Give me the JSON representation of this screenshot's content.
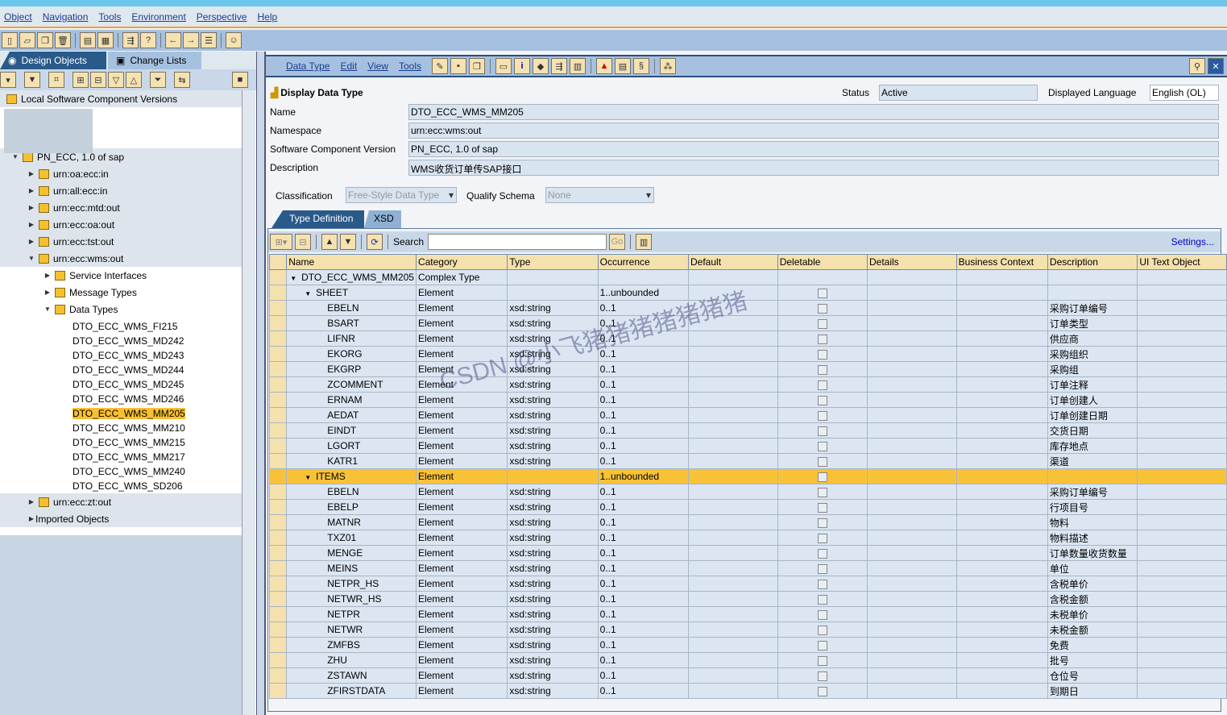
{
  "menu": [
    "Object",
    "Navigation",
    "Tools",
    "Environment",
    "Perspective",
    "Help"
  ],
  "left_tabs": {
    "design": "Design Objects",
    "changes": "Change Lists"
  },
  "tree": [
    {
      "label": "Local Software Component Versions",
      "level": 0,
      "arrow": "",
      "grey": true
    },
    {
      "label": "PN_ECC, 1.0 of sap",
      "level": 1,
      "arrow": "down",
      "grey": true
    },
    {
      "label": "urn:oa:ecc:in",
      "level": 2,
      "arrow": "right",
      "grey": true,
      "icon": true
    },
    {
      "label": "urn:all:ecc:in",
      "level": 2,
      "arrow": "right",
      "grey": true,
      "icon": true
    },
    {
      "label": "urn:ecc:mtd:out",
      "level": 2,
      "arrow": "right",
      "grey": true,
      "icon": true
    },
    {
      "label": "urn:ecc:oa:out",
      "level": 2,
      "arrow": "right",
      "grey": true,
      "icon": true
    },
    {
      "label": "urn:ecc:tst:out",
      "level": 2,
      "arrow": "right",
      "grey": true,
      "icon": true
    },
    {
      "label": "urn:ecc:wms:out",
      "level": 2,
      "arrow": "down",
      "grey": true,
      "icon": true
    },
    {
      "label": "Service Interfaces",
      "level": 3,
      "arrow": "right",
      "icon": true
    },
    {
      "label": "Message Types",
      "level": 3,
      "arrow": "right",
      "icon": true
    },
    {
      "label": "Data Types",
      "level": 3,
      "arrow": "down",
      "icon": true
    },
    {
      "label": "DTO_ECC_WMS_FI215",
      "level": 4
    },
    {
      "label": "DTO_ECC_WMS_MD242",
      "level": 4
    },
    {
      "label": "DTO_ECC_WMS_MD243",
      "level": 4
    },
    {
      "label": "DTO_ECC_WMS_MD244",
      "level": 4
    },
    {
      "label": "DTO_ECC_WMS_MD245",
      "level": 4
    },
    {
      "label": "DTO_ECC_WMS_MD246",
      "level": 4
    },
    {
      "label": "DTO_ECC_WMS_MM205",
      "level": 4,
      "selected": true
    },
    {
      "label": "DTO_ECC_WMS_MM210",
      "level": 4
    },
    {
      "label": "DTO_ECC_WMS_MM215",
      "level": 4
    },
    {
      "label": "DTO_ECC_WMS_MM217",
      "level": 4
    },
    {
      "label": "DTO_ECC_WMS_MM240",
      "level": 4
    },
    {
      "label": "DTO_ECC_WMS_SD206",
      "level": 4
    },
    {
      "label": "urn:ecc:zt:out",
      "level": 2,
      "arrow": "right",
      "grey": true,
      "icon": true
    },
    {
      "label": "Imported Objects",
      "level": 2,
      "arrow": "right",
      "grey": true
    }
  ],
  "editor_menu": [
    "Data Type",
    "Edit",
    "View",
    "Tools"
  ],
  "header": {
    "title": "Display Data Type",
    "status_label": "Status",
    "status": "Active",
    "lang_label": "Displayed Language",
    "lang": "English (OL)"
  },
  "fields": [
    {
      "label": "Name",
      "value": "DTO_ECC_WMS_MM205"
    },
    {
      "label": "Namespace",
      "value": "urn:ecc:wms:out"
    },
    {
      "label": "Software Component Version",
      "value": "PN_ECC, 1.0 of sap"
    },
    {
      "label": "Description",
      "value": "WMS收货订单传SAP接口"
    }
  ],
  "classification": {
    "label": "Classification",
    "value": "Free-Style Data Type",
    "qs_label": "Qualify Schema",
    "qs_value": "None"
  },
  "tabs": [
    "Type Definition",
    "XSD"
  ],
  "search": {
    "label": "Search",
    "value": "",
    "go": "Go",
    "settings": "Settings..."
  },
  "columns": [
    "Name",
    "Category",
    "Type",
    "Occurrence",
    "Default",
    "Deletable",
    "Details",
    "Business Context",
    "Description",
    "UI Text Object"
  ],
  "rows": [
    {
      "name": "DTO_ECC_WMS_MM205",
      "indent": 0,
      "arrow": true,
      "category": "Complex Type",
      "type": "",
      "occ": "",
      "del": false,
      "desc": ""
    },
    {
      "name": "SHEET",
      "indent": 1,
      "arrow": true,
      "category": "Element",
      "type": "",
      "occ": "1..unbounded",
      "del": true,
      "desc": ""
    },
    {
      "name": "EBELN",
      "indent": 2,
      "category": "Element",
      "type": "xsd:string",
      "occ": "0..1",
      "del": true,
      "desc": "采购订单编号"
    },
    {
      "name": "BSART",
      "indent": 2,
      "category": "Element",
      "type": "xsd:string",
      "occ": "0..1",
      "del": true,
      "desc": "订单类型"
    },
    {
      "name": "LIFNR",
      "indent": 2,
      "category": "Element",
      "type": "xsd:string",
      "occ": "0..1",
      "del": true,
      "desc": "供应商"
    },
    {
      "name": "EKORG",
      "indent": 2,
      "category": "Element",
      "type": "xsd:string",
      "occ": "0..1",
      "del": true,
      "desc": "采购组织"
    },
    {
      "name": "EKGRP",
      "indent": 2,
      "category": "Element",
      "type": "xsd:string",
      "occ": "0..1",
      "del": true,
      "desc": "采购组"
    },
    {
      "name": "ZCOMMENT",
      "indent": 2,
      "category": "Element",
      "type": "xsd:string",
      "occ": "0..1",
      "del": true,
      "desc": "订单注释"
    },
    {
      "name": "ERNAM",
      "indent": 2,
      "category": "Element",
      "type": "xsd:string",
      "occ": "0..1",
      "del": true,
      "desc": "订单创建人"
    },
    {
      "name": "AEDAT",
      "indent": 2,
      "category": "Element",
      "type": "xsd:string",
      "occ": "0..1",
      "del": true,
      "desc": "订单创建日期"
    },
    {
      "name": "EINDT",
      "indent": 2,
      "category": "Element",
      "type": "xsd:string",
      "occ": "0..1",
      "del": true,
      "desc": "交货日期"
    },
    {
      "name": "LGORT",
      "indent": 2,
      "category": "Element",
      "type": "xsd:string",
      "occ": "0..1",
      "del": true,
      "desc": "库存地点"
    },
    {
      "name": "KATR1",
      "indent": 2,
      "category": "Element",
      "type": "xsd:string",
      "occ": "0..1",
      "del": true,
      "desc": "渠道"
    },
    {
      "name": "ITEMS",
      "indent": 1,
      "arrow": true,
      "category": "Element",
      "type": "",
      "occ": "1..unbounded",
      "del": true,
      "desc": "",
      "selected": true
    },
    {
      "name": "EBELN",
      "indent": 2,
      "category": "Element",
      "type": "xsd:string",
      "occ": "0..1",
      "del": true,
      "desc": "采购订单编号"
    },
    {
      "name": "EBELP",
      "indent": 2,
      "category": "Element",
      "type": "xsd:string",
      "occ": "0..1",
      "del": true,
      "desc": "行项目号"
    },
    {
      "name": "MATNR",
      "indent": 2,
      "category": "Element",
      "type": "xsd:string",
      "occ": "0..1",
      "del": true,
      "desc": "物料"
    },
    {
      "name": "TXZ01",
      "indent": 2,
      "category": "Element",
      "type": "xsd:string",
      "occ": "0..1",
      "del": true,
      "desc": "物料描述"
    },
    {
      "name": "MENGE",
      "indent": 2,
      "category": "Element",
      "type": "xsd:string",
      "occ": "0..1",
      "del": true,
      "desc": "订单数量收货数量"
    },
    {
      "name": "MEINS",
      "indent": 2,
      "category": "Element",
      "type": "xsd:string",
      "occ": "0..1",
      "del": true,
      "desc": "单位"
    },
    {
      "name": "NETPR_HS",
      "indent": 2,
      "category": "Element",
      "type": "xsd:string",
      "occ": "0..1",
      "del": true,
      "desc": "含税单价"
    },
    {
      "name": "NETWR_HS",
      "indent": 2,
      "category": "Element",
      "type": "xsd:string",
      "occ": "0..1",
      "del": true,
      "desc": "含税金额"
    },
    {
      "name": "NETPR",
      "indent": 2,
      "category": "Element",
      "type": "xsd:string",
      "occ": "0..1",
      "del": true,
      "desc": "未税单价"
    },
    {
      "name": "NETWR",
      "indent": 2,
      "category": "Element",
      "type": "xsd:string",
      "occ": "0..1",
      "del": true,
      "desc": "未税金额"
    },
    {
      "name": "ZMFBS",
      "indent": 2,
      "category": "Element",
      "type": "xsd:string",
      "occ": "0..1",
      "del": true,
      "desc": "免费"
    },
    {
      "name": "ZHU",
      "indent": 2,
      "category": "Element",
      "type": "xsd:string",
      "occ": "0..1",
      "del": true,
      "desc": "批号"
    },
    {
      "name": "ZSTAWN",
      "indent": 2,
      "category": "Element",
      "type": "xsd:string",
      "occ": "0..1",
      "del": true,
      "desc": "仓位号"
    },
    {
      "name": "ZFIRSTDATA",
      "indent": 2,
      "category": "Element",
      "type": "xsd:string",
      "occ": "0..1",
      "del": true,
      "desc": "到期日"
    }
  ],
  "watermark": "CSDN @小飞猪猪猪猪猪猪猪",
  "colors": {
    "accent": "#f0a030",
    "selection": "#f8c238",
    "header": "#f5e1ae",
    "toolbar": "#a6c1e0"
  }
}
